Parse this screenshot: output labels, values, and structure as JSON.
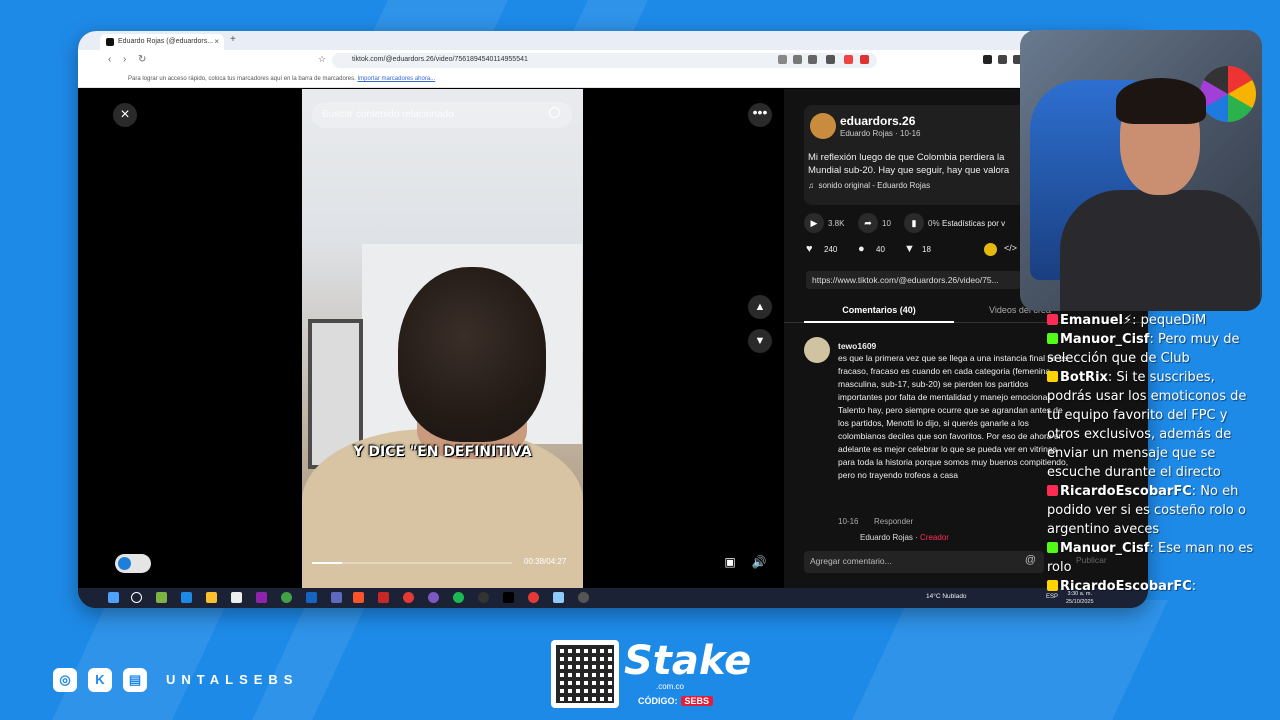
{
  "browser": {
    "tab_title": "Eduardo Rojas (@eduardors...",
    "url": "tiktok.com/@eduardors.26/video/7561894540114955541",
    "bookmarks_text": "Para lograr un acceso rápido, coloca tus marcadores aquí en la barra de marcadores.",
    "bookmarks_link": "Importar marcadores ahora..."
  },
  "video": {
    "search_placeholder": "Buscar contenido relacionado",
    "caption": "Y DICE \"EN DEFINITIVA",
    "time": "00:38/04:27",
    "progress": 0.15
  },
  "post": {
    "author": "eduardors.26",
    "author_sub": "Eduardo Rojas · 10-16",
    "desc_line1": "Mi reflexión luego de que Colombia perdiera la",
    "desc_line2": "Mundial sub-20. Hay que seguir, hay que valora",
    "sound": "sonido original - Eduardo Rojas",
    "plays": "3.8K",
    "shares": "10",
    "stats_pct": "0%",
    "stats_label": "Estadísticas por v",
    "likes": "240",
    "comments": "40",
    "saves": "18",
    "link": "https://www.tiktok.com/@eduardors.26/video/75..."
  },
  "comments": {
    "tab_comments": "Comentarios (40)",
    "tab_videos": "Videos del crea",
    "user": "tewo1609",
    "text": "es que la primera vez que se llega a una instancia final no es fracaso, fracaso es cuando en cada categoria (femenina, masculina, sub-17, sub-20) se pierden los partidos importantes por falta de mentalidad y manejo emocional. Talento hay, pero siempre ocurre que se agrandan antes de los partidos, Menotti lo dijo, si querés ganarle a los colombianos deciles que son favoritos. Por eso de ahora en adelante es mejor celebrar lo que se pueda ver en vitrinas para toda la historia porque somos muy buenos compitiendo, pero no trayendo trofeos a casa",
    "date": "10-16",
    "reply_label": "Responder",
    "creator_reply_name": "Eduardo Rojas",
    "creator_tag": "Creador",
    "add_placeholder": "Agregar comentario...",
    "publish": "Publicar"
  },
  "taskbar": {
    "weather": "14°C  Nublado",
    "lang": "ESP",
    "time": "3:30 a. m.",
    "date": "25/10/2025"
  },
  "chat": [
    {
      "user": "Emanuel",
      "sep": "⚡:",
      "text": " pequeDiM"
    },
    {
      "user": "Manuor_Cisf",
      "sep": ":",
      "text": " Pero muy de selección que de Club"
    },
    {
      "user": "BotRix",
      "sep": ":",
      "text": " Si te suscribes, podrás usar los emoticonos de tu equipo favorito del FPC y otros exclusivos, además de enviar un mensaje que se escuche durante el directo"
    },
    {
      "user": "RicardoEscobarFC",
      "sep": ":",
      "text": " No eh podido ver si es costeño rolo o argentino aveces"
    },
    {
      "user": "Manuor_Cisf",
      "sep": ":",
      "text": " Ese man no es rolo"
    },
    {
      "user": "RicardoEscobarFC",
      "sep": ":",
      "text": ""
    }
  ],
  "overlay": {
    "handle": "UNTALSEBS",
    "sponsor": "Stake",
    "sponsor_domain": ".com.co",
    "code_label": "CÓDIGO:",
    "code": "SEBS"
  },
  "colors": {
    "background": "#1e8ae8",
    "tiktok_red": "#fe2c55"
  }
}
